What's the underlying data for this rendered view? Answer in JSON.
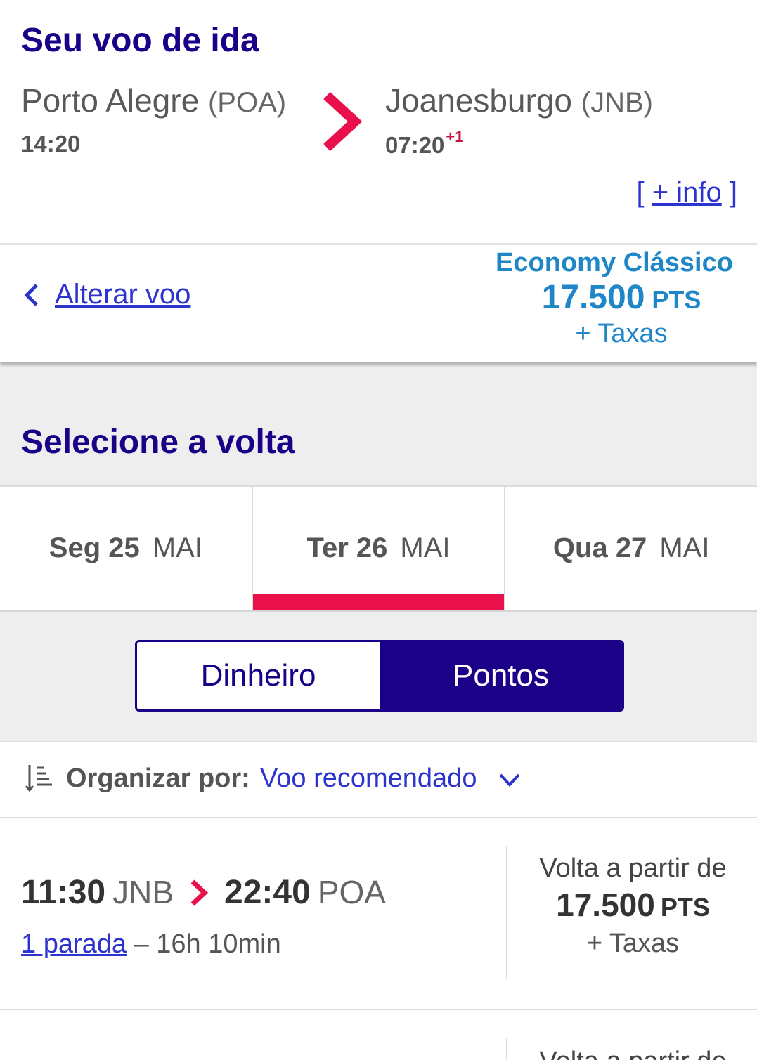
{
  "outbound": {
    "title": "Seu voo de ida",
    "origin_city": "Porto Alegre",
    "origin_code": "(POA)",
    "origin_time": "14:20",
    "dest_city": "Joanesburgo",
    "dest_code": "(JNB)",
    "dest_time": "07:20",
    "dest_day_offset": "+1",
    "more_info_open": "[",
    "more_info_label": "+ info",
    "more_info_close": "]"
  },
  "selected": {
    "change_label": "Alterar voo",
    "fare_name": "Economy Clássico",
    "points": "17.500",
    "points_unit": "PTS",
    "taxes": "+ Taxas"
  },
  "return_section": {
    "title": "Selecione a volta"
  },
  "date_tabs": [
    {
      "day": "Seg 25",
      "month": "MAI",
      "active": false
    },
    {
      "day": "Ter 26",
      "month": "MAI",
      "active": true
    },
    {
      "day": "Qua 27",
      "month": "MAI",
      "active": false
    }
  ],
  "payment_toggle": {
    "money_label": "Dinheiro",
    "points_label": "Pontos",
    "selected": "Pontos"
  },
  "sort": {
    "label": "Organizar por:",
    "value": "Voo recomendado"
  },
  "flights": [
    {
      "depart_time": "11:30",
      "depart_code": "JNB",
      "arrive_time": "22:40",
      "arrive_code": "POA",
      "stops_label": "1 parada",
      "duration": "– 16h 10min",
      "price_from": "Volta a partir de",
      "points": "17.500",
      "points_unit": "PTS",
      "taxes": "+ Taxas"
    },
    {
      "price_from": "Volta a partir de"
    }
  ],
  "colors": {
    "brand_navy": "#1b0088",
    "accent_red": "#e8114b",
    "link_blue": "#2d34ce",
    "fare_blue": "#1f86c8",
    "background_grey": "#eeeeee"
  },
  "icons": {
    "route_arrow": "chevron-right-icon",
    "back": "chevron-left-icon",
    "sort": "sort-icon",
    "dropdown": "chevron-down-icon"
  }
}
